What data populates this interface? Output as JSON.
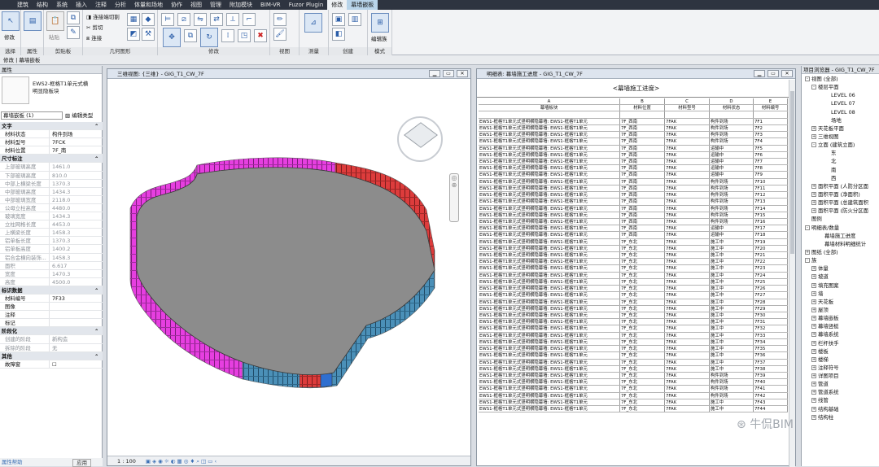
{
  "menubar": {
    "tabs": [
      "建筑",
      "结构",
      "系统",
      "插入",
      "注释",
      "分析",
      "体量和场地",
      "协作",
      "视图",
      "管理",
      "附加模块",
      "BIM-VR",
      "Fuzor Plugin",
      "修改",
      "幕墙嵌板"
    ],
    "active_index": 14,
    "highlight_index": 13
  },
  "ribbon": {
    "groups": [
      "选择",
      "属性",
      "剪贴板",
      "几何图形",
      "修改",
      "视图",
      "测量",
      "创建",
      "模式"
    ],
    "modify_label": "修改",
    "paste_label": "粘贴",
    "tools": {
      "connect_end_cut": "连接端切割",
      "cut": "剪切",
      "join": "连接"
    },
    "edit_family_label": "编辑族"
  },
  "context_bar": "修改 | 幕墙嵌板",
  "properties": {
    "title": "属性",
    "type_name_line1": "EWS2-框格T1单元式横",
    "type_name_line2": "明显隐板块",
    "selector": "幕墙嵌板 (1)",
    "edit_type": "编辑类型",
    "rows": [
      {
        "k": "文字",
        "section": true
      },
      {
        "k": "材料状态",
        "v": "构件到场",
        "ro": false
      },
      {
        "k": "材料型号",
        "v": "7FCK",
        "ro": false
      },
      {
        "k": "材料位置",
        "v": "7F_南",
        "ro": false
      },
      {
        "k": "尺寸标注",
        "section": true
      },
      {
        "k": "上部玻璃高度",
        "v": "1461.0",
        "ro": true
      },
      {
        "k": "下部玻璃高度",
        "v": "810.0",
        "ro": true
      },
      {
        "k": "中部上横梁长度",
        "v": "1370.3",
        "ro": true
      },
      {
        "k": "中部玻璃高度",
        "v": "1434.3",
        "ro": true
      },
      {
        "k": "中部玻璃宽度",
        "v": "2118.0",
        "ro": true
      },
      {
        "k": "公母立柱高度",
        "v": "4480.0",
        "ro": true
      },
      {
        "k": "玻璃宽度",
        "v": "1434.3",
        "ro": true
      },
      {
        "k": "立柱网格长度",
        "v": "4453.0",
        "ro": true
      },
      {
        "k": "上横梁长度",
        "v": "1458.3",
        "ro": true
      },
      {
        "k": "铝单板长度",
        "v": "1370.3",
        "ro": true
      },
      {
        "k": "铝单板高度",
        "v": "1400.2",
        "ro": true
      },
      {
        "k": "铝合金横向装饰...",
        "v": "1458.3",
        "ro": true
      },
      {
        "k": "面积",
        "v": "6.617",
        "ro": true
      },
      {
        "k": "宽度",
        "v": "1470.3",
        "ro": true
      },
      {
        "k": "高度",
        "v": "4500.0",
        "ro": true
      },
      {
        "k": "标识数据",
        "section": true
      },
      {
        "k": "材料编号",
        "v": "7F33",
        "ro": false
      },
      {
        "k": "图像",
        "v": "",
        "ro": false
      },
      {
        "k": "注释",
        "v": "",
        "ro": false
      },
      {
        "k": "标记",
        "v": "",
        "ro": false
      },
      {
        "k": "阶段化",
        "section": true
      },
      {
        "k": "创建的阶段",
        "v": "新构造",
        "ro": true
      },
      {
        "k": "拆除的阶段",
        "v": "无",
        "ro": true
      },
      {
        "k": "其他",
        "section": true
      },
      {
        "k": "故障窗",
        "v": "☐",
        "ro": false
      }
    ],
    "help_link": "属性帮助",
    "apply_label": "应用"
  },
  "view3d": {
    "title": "三维视图: {三维} - GIG_T1_CW_7F",
    "scale": "1 : 100"
  },
  "schedule": {
    "window_title": "明细表: 幕墙施工进度 - GIG_T1_CW_7F",
    "title": "<幕墙施工进度>",
    "col_letters": [
      "A",
      "B",
      "C",
      "D",
      "E"
    ],
    "col_headers": [
      "幕墙板块",
      "材料位置",
      "材料型号",
      "材料状态",
      "材料编号"
    ],
    "rows": [
      [
        "EWS1-框格T1单元式竖明横隐幕墙: EWS1-框格T1单元",
        "7F_西南",
        "7FAK",
        "构件到场",
        "7F1"
      ],
      [
        "EWS1-框格T1单元式竖明横隐幕墙: EWS1-框格T1单元",
        "7F_西南",
        "7FAK",
        "构件到场",
        "7F2"
      ],
      [
        "EWS1-框格T1单元式竖明横隐幕墙: EWS1-框格T1单元",
        "7F_西南",
        "7FAK",
        "构件到场",
        "7F3"
      ],
      [
        "EWS1-框格T1单元式竖明横隐幕墙: EWS1-框格T1单元",
        "7F_西南",
        "7FAK",
        "构件到场",
        "7F4"
      ],
      [
        "EWS1-框格T1单元式竖明横隐幕墙: EWS1-框格T1单元",
        "7F_西南",
        "7FAK",
        "运输中",
        "7F5"
      ],
      [
        "EWS1-框格T1单元式竖明横隐幕墙: EWS1-框格T1单元",
        "7F_西南",
        "7FAK",
        "运输中",
        "7F6"
      ],
      [
        "EWS1-框格T1单元式竖明横隐幕墙: EWS1-框格T1单元",
        "7F_西南",
        "7FAK",
        "运输中",
        "7F7"
      ],
      [
        "EWS1-框格T1单元式竖明横隐幕墙: EWS1-框格T1单元",
        "7F_西南",
        "7FAK",
        "运输中",
        "7F8"
      ],
      [
        "EWS1-框格T1单元式竖明横隐幕墙: EWS1-框格T1单元",
        "7F_西南",
        "7FAK",
        "运输中",
        "7F9"
      ],
      [
        "EWS1-框格T1单元式竖明横隐幕墙: EWS1-框格T1单元",
        "7F_西南",
        "7FAK",
        "构件到场",
        "7F10"
      ],
      [
        "EWS1-框格T1单元式竖明横隐幕墙: EWS1-框格T1单元",
        "7F_西南",
        "7FAK",
        "构件到场",
        "7F11"
      ],
      [
        "EWS1-框格T1单元式竖明横隐幕墙: EWS1-框格T1单元",
        "7F_西南",
        "7FAK",
        "构件到场",
        "7F12"
      ],
      [
        "EWS1-框格T1单元式竖明横隐幕墙: EWS1-框格T1单元",
        "7F_西南",
        "7FAK",
        "构件到场",
        "7F13"
      ],
      [
        "EWS1-框格T1单元式竖明横隐幕墙: EWS1-框格T1单元",
        "7F_西南",
        "7FAK",
        "构件到场",
        "7F14"
      ],
      [
        "EWS1-框格T1单元式竖明横隐幕墙: EWS1-框格T1单元",
        "7F_西南",
        "7FAK",
        "构件到场",
        "7F15"
      ],
      [
        "EWS1-框格T1单元式竖明横隐幕墙: EWS1-框格T1单元",
        "7F_西南",
        "7FAK",
        "构件到场",
        "7F16"
      ],
      [
        "EWS1-框格T1单元式竖明横隐幕墙: EWS1-框格T1单元",
        "7F_西南",
        "7FAK",
        "运输中",
        "7F17"
      ],
      [
        "EWS1-框格T1单元式竖明横隐幕墙: EWS1-框格T1单元",
        "7F_西南",
        "7FAK",
        "运输中",
        "7F18"
      ],
      [
        "EWS1-框格T1单元式竖明横隐幕墙: EWS1-框格T1单元",
        "7F_东北",
        "7FAK",
        "施工中",
        "7F19"
      ],
      [
        "EWS1-框格T1单元式竖明横隐幕墙: EWS1-框格T1单元",
        "7F_东北",
        "7FAK",
        "施工中",
        "7F20"
      ],
      [
        "EWS1-框格T1单元式竖明横隐幕墙: EWS1-框格T1单元",
        "7F_东北",
        "7FAK",
        "施工中",
        "7F21"
      ],
      [
        "EWS1-框格T1单元式竖明横隐幕墙: EWS1-框格T1单元",
        "7F_东北",
        "7FAK",
        "施工中",
        "7F22"
      ],
      [
        "EWS1-框格T1单元式竖明横隐幕墙: EWS1-框格T1单元",
        "7F_东北",
        "7FAK",
        "施工中",
        "7F23"
      ],
      [
        "EWS1-框格T1单元式竖明横隐幕墙: EWS1-框格T1单元",
        "7F_东北",
        "7FAK",
        "施工中",
        "7F24"
      ],
      [
        "EWS1-框格T1单元式竖明横隐幕墙: EWS1-框格T1单元",
        "7F_东北",
        "7FAK",
        "施工中",
        "7F25"
      ],
      [
        "EWS1-框格T1单元式竖明横隐幕墙: EWS1-框格T1单元",
        "7F_东北",
        "7FAK",
        "施工中",
        "7F26"
      ],
      [
        "EWS1-框格T1单元式竖明横隐幕墙: EWS1-框格T1单元",
        "7F_东北",
        "7FAK",
        "施工中",
        "7F27"
      ],
      [
        "EWS1-框格T1单元式竖明横隐幕墙: EWS1-框格T1单元",
        "7F_东北",
        "7FAK",
        "施工中",
        "7F28"
      ],
      [
        "EWS1-框格T1单元式竖明横隐幕墙: EWS1-框格T1单元",
        "7F_东北",
        "7FAK",
        "施工中",
        "7F29"
      ],
      [
        "EWS1-框格T1单元式竖明横隐幕墙: EWS1-框格T1单元",
        "7F_东北",
        "7FAK",
        "施工中",
        "7F30"
      ],
      [
        "EWS1-框格T1单元式竖明横隐幕墙: EWS1-框格T1单元",
        "7F_东北",
        "7FAK",
        "施工中",
        "7F31"
      ],
      [
        "EWS1-框格T1单元式竖明横隐幕墙: EWS1-框格T1单元",
        "7F_东北",
        "7FAK",
        "施工中",
        "7F32"
      ],
      [
        "EWS1-框格T1单元式竖明横隐幕墙: EWS1-框格T1单元",
        "7F_东北",
        "7FAK",
        "施工中",
        "7F33"
      ],
      [
        "EWS1-框格T1单元式竖明横隐幕墙: EWS1-框格T1单元",
        "7F_东北",
        "7FAK",
        "施工中",
        "7F34"
      ],
      [
        "EWS1-框格T1单元式竖明横隐幕墙: EWS1-框格T1单元",
        "7F_东北",
        "7FAK",
        "施工中",
        "7F35"
      ],
      [
        "EWS1-框格T1单元式竖明横隐幕墙: EWS1-框格T1单元",
        "7F_东北",
        "7FAK",
        "施工中",
        "7F36"
      ],
      [
        "EWS1-框格T1单元式竖明横隐幕墙: EWS1-框格T1单元",
        "7F_东北",
        "7FAK",
        "施工中",
        "7F37"
      ],
      [
        "EWS1-框格T1单元式竖明横隐幕墙: EWS1-框格T1单元",
        "7F_东北",
        "7FAK",
        "施工中",
        "7F38"
      ],
      [
        "EWS1-框格T1单元式竖明横隐幕墙: EWS1-框格T1单元",
        "7F_东北",
        "7FAK",
        "构件到场",
        "7F39"
      ],
      [
        "EWS1-框格T1单元式竖明横隐幕墙: EWS1-框格T1单元",
        "7F_东北",
        "7FAK",
        "构件到场",
        "7F40"
      ],
      [
        "EWS1-框格T1单元式竖明横隐幕墙: EWS1-框格T1单元",
        "7F_东北",
        "7FAK",
        "构件到场",
        "7F41"
      ],
      [
        "EWS1-框格T1单元式竖明横隐幕墙: EWS1-框格T1单元",
        "7F_东北",
        "7FAK",
        "构件到场",
        "7F42"
      ],
      [
        "EWS1-框格T1单元式竖明横隐幕墙: EWS1-框格T1单元",
        "7F_东北",
        "7FAK",
        "施工中",
        "7F43"
      ],
      [
        "EWS1-框格T1单元式竖明横隐幕墙: EWS1-框格T1单元",
        "7F_东北",
        "7FAK",
        "施工中",
        "7F44"
      ]
    ]
  },
  "browser": {
    "title": "项目浏览器 - GIG_T1_CW_7F",
    "nodes": [
      {
        "t": "视图 (全部)",
        "lvl": 0,
        "exp": "-"
      },
      {
        "t": "楼层平面",
        "lvl": 1,
        "exp": "-"
      },
      {
        "t": "LEVEL 06",
        "lvl": 3
      },
      {
        "t": "LEVEL 07",
        "lvl": 3
      },
      {
        "t": "LEVEL 08",
        "lvl": 3
      },
      {
        "t": "场地",
        "lvl": 3
      },
      {
        "t": "天花板平面",
        "lvl": 1,
        "exp": "+"
      },
      {
        "t": "三维视图",
        "lvl": 1,
        "exp": "+"
      },
      {
        "t": "立面 (建筑立面)",
        "lvl": 1,
        "exp": "-"
      },
      {
        "t": "东",
        "lvl": 3
      },
      {
        "t": "北",
        "lvl": 3
      },
      {
        "t": "南",
        "lvl": 3
      },
      {
        "t": "西",
        "lvl": 3
      },
      {
        "t": "面积平面 (人防分区面",
        "lvl": 1,
        "exp": "+"
      },
      {
        "t": "面积平面 (净面积)",
        "lvl": 1,
        "exp": "+"
      },
      {
        "t": "面积平面 (总建筑面积",
        "lvl": 1,
        "exp": "+"
      },
      {
        "t": "面积平面 (防火分区面",
        "lvl": 1,
        "exp": "+"
      },
      {
        "t": "图例",
        "lvl": 0
      },
      {
        "t": "明细表/数量",
        "lvl": 0,
        "exp": "-"
      },
      {
        "t": "幕墙施工进度",
        "lvl": 2
      },
      {
        "t": "幕墙材料明细统计",
        "lvl": 2
      },
      {
        "t": "图纸 (全部)",
        "lvl": 0,
        "exp": "+"
      },
      {
        "t": "族",
        "lvl": 0,
        "exp": "-"
      },
      {
        "t": "体量",
        "lvl": 1,
        "exp": "+"
      },
      {
        "t": "坡道",
        "lvl": 1,
        "exp": "+"
      },
      {
        "t": "填充图案",
        "lvl": 1,
        "exp": "+"
      },
      {
        "t": "墙",
        "lvl": 1,
        "exp": "+"
      },
      {
        "t": "天花板",
        "lvl": 1,
        "exp": "+"
      },
      {
        "t": "屋顶",
        "lvl": 1,
        "exp": "+"
      },
      {
        "t": "幕墙嵌板",
        "lvl": 1,
        "exp": "+"
      },
      {
        "t": "幕墙竖梃",
        "lvl": 1,
        "exp": "+"
      },
      {
        "t": "幕墙系统",
        "lvl": 1,
        "exp": "+"
      },
      {
        "t": "栏杆扶手",
        "lvl": 1,
        "exp": "+"
      },
      {
        "t": "楼板",
        "lvl": 1,
        "exp": "+"
      },
      {
        "t": "楼梯",
        "lvl": 1,
        "exp": "+"
      },
      {
        "t": "注释符号",
        "lvl": 1,
        "exp": "+"
      },
      {
        "t": "详图项目",
        "lvl": 1,
        "exp": "+"
      },
      {
        "t": "管道",
        "lvl": 1,
        "exp": "+"
      },
      {
        "t": "管道系统",
        "lvl": 1,
        "exp": "+"
      },
      {
        "t": "线管",
        "lvl": 1,
        "exp": "+"
      },
      {
        "t": "结构基础",
        "lvl": 1,
        "exp": "+"
      },
      {
        "t": "结构柱",
        "lvl": 1,
        "exp": "+"
      }
    ]
  },
  "watermark": "牛侃BIM",
  "colors": {
    "accent": "#2e6db4",
    "magenta": "#e23de0",
    "red": "#d23a3a",
    "teal": "#3e8ab4"
  }
}
